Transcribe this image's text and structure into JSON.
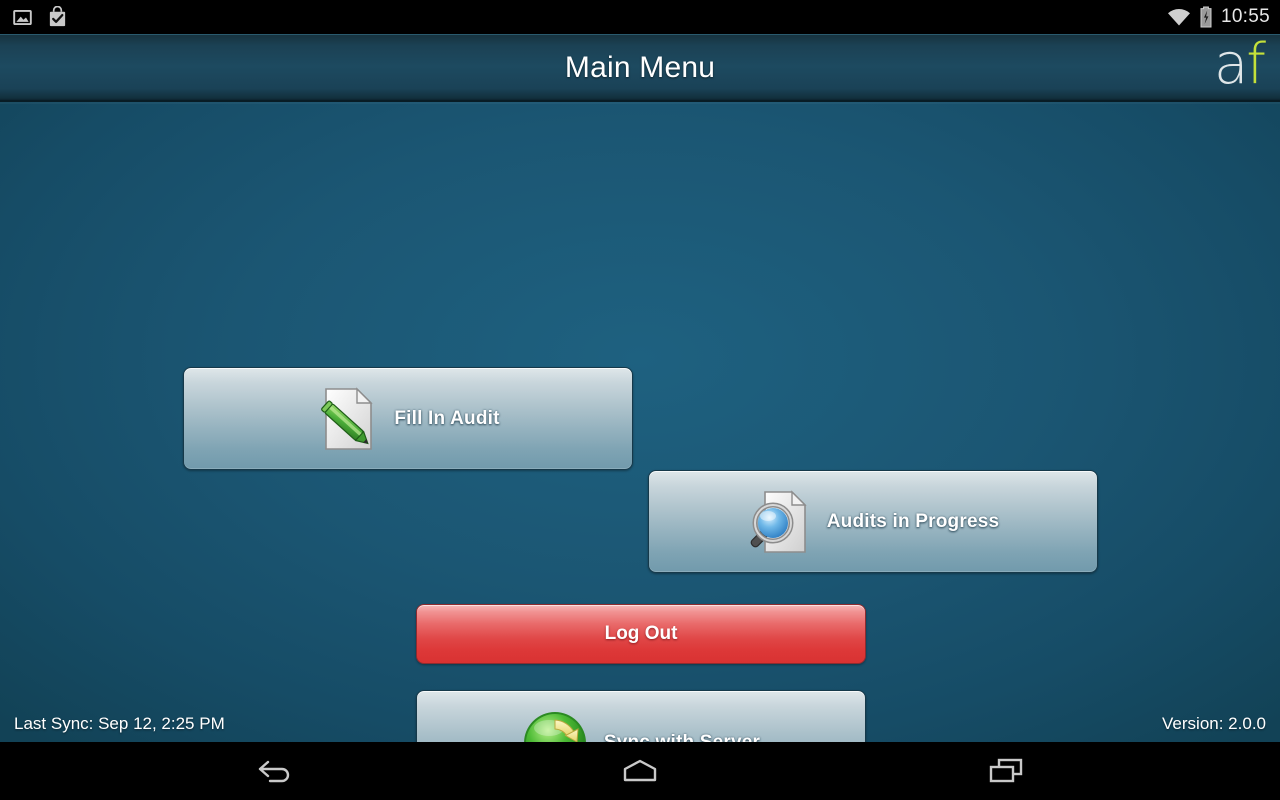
{
  "statusbar": {
    "time": "10:55",
    "icons": [
      "gallery-icon",
      "checkbox-app-icon",
      "wifi-icon",
      "battery-charging-icon"
    ]
  },
  "titlebar": {
    "title": "Main Menu",
    "logo_primary": "a",
    "logo_accent": "f",
    "logo_primary_color": "#dfe6e8",
    "logo_accent_color": "#c4e03a"
  },
  "menu": {
    "buttons": [
      {
        "label": "Fill In Audit",
        "icon": "document-pencil-icon"
      },
      {
        "label": "Audits in Progress",
        "icon": "document-magnifier-icon"
      },
      {
        "label": "Sync with Server",
        "icon": "sync-refresh-icon"
      }
    ],
    "logout": {
      "label": "Log Out",
      "color": "#e04747"
    }
  },
  "footer": {
    "last_sync": "Last Sync: Sep 12, 2:25 PM",
    "version": "Version: 2.0.0"
  },
  "navbar": {
    "back": "back-icon",
    "home": "home-icon",
    "recents": "recent-apps-icon"
  },
  "theme": {
    "background": "#1b5673",
    "titlebar": "#1d4a60",
    "button_face": "#aec3cc"
  }
}
